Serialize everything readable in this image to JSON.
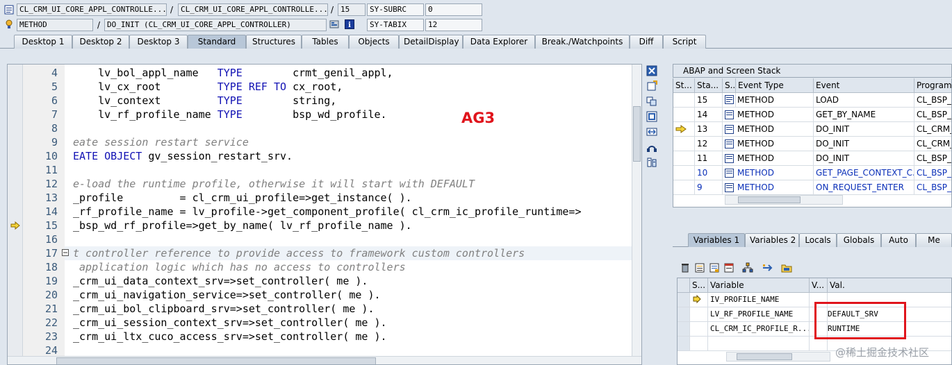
{
  "header": {
    "row1": {
      "field1": "CL_CRM_UI_CORE_APPL_CONTROLLE...",
      "sep1": "/",
      "field2": "CL_CRM_UI_CORE_APPL_CONTROLLE...",
      "sep2": "/",
      "line": "15",
      "sysvar": "SY-SUBRC",
      "sysval": "0"
    },
    "row2": {
      "type": "METHOD",
      "sep": "/",
      "method": "DO_INIT (CL_CRM_UI_CORE_APPL_CONTROLLER)",
      "sysvar": "SY-TABIX",
      "sysval": "12"
    }
  },
  "tabs": [
    "Desktop 1",
    "Desktop 2",
    "Desktop 3",
    "Standard",
    "Structures",
    "Tables",
    "Objects",
    "DetailDisplay",
    "Data Explorer",
    "Break./Watchpoints",
    "Diff",
    "Script"
  ],
  "editor": {
    "lines": [
      {
        "n": "4"
      },
      {
        "n": "5"
      },
      {
        "n": "6"
      },
      {
        "n": "7"
      },
      {
        "n": "8"
      },
      {
        "n": "9"
      },
      {
        "n": "10"
      },
      {
        "n": "11"
      },
      {
        "n": "12"
      },
      {
        "n": "13"
      },
      {
        "n": "14"
      },
      {
        "n": "15"
      },
      {
        "n": "16"
      },
      {
        "n": "17"
      },
      {
        "n": "18"
      },
      {
        "n": "19"
      },
      {
        "n": "20"
      },
      {
        "n": "21"
      },
      {
        "n": "22"
      },
      {
        "n": "23"
      },
      {
        "n": "24"
      }
    ],
    "code": {
      "l4a": "    lv_bol_appl_name   ",
      "l4b": "TYPE",
      "l4c": "        crmt_genil_appl,",
      "l5a": "    lv_cx_root         ",
      "l5b": "TYPE REF TO",
      "l5c": " cx_root,",
      "l6a": "    lv_context         ",
      "l6b": "TYPE",
      "l6c": "        string,",
      "l7a": "    lv_rf_profile_name ",
      "l7b": "TYPE",
      "l7c": "        bsp_wd_profile.",
      "l9": "eate session restart service",
      "l10a": "EATE OBJECT",
      "l10b": " gv_session_restart_srv.",
      "l12": "e-load the runtime profile, otherwise it will start with DEFAULT",
      "l13": "_profile         = cl_crm_ui_profile=>get_instance( ).",
      "l14": "_rf_profile_name = lv_profile->get_component_profile( cl_crm_ic_profile_runtime=>",
      "l15": "_bsp_wd_rf_profile=>get_by_name( lv_rf_profile_name ).",
      "l17": "t controller reference to provide access to framework custom controllers",
      "l18": " application logic which has no access to controllers",
      "l19": "_crm_ui_data_context_srv=>set_controller( me ).",
      "l20": "_crm_ui_navigation_service=>set_controller( me ).",
      "l21": "_crm_ui_bol_clipboard_srv=>set_controller( me ).",
      "l22": "_crm_ui_session_context_srv=>set_controller( me ).",
      "l23": "_crm_ui_ltx_cuco_access_srv=>set_controller( me )."
    }
  },
  "annotation": "AG3",
  "stack": {
    "title": "ABAP and Screen Stack",
    "columns": [
      "St...",
      "Sta...",
      "S...",
      "Event Type",
      "Event",
      "Program"
    ],
    "rows": [
      {
        "lvl": "15",
        "type": "METHOD",
        "event": "LOAD",
        "prog": "CL_BSP_W",
        "blue": false,
        "current": false
      },
      {
        "lvl": "14",
        "type": "METHOD",
        "event": "GET_BY_NAME",
        "prog": "CL_BSP_W",
        "blue": false,
        "current": false
      },
      {
        "lvl": "13",
        "type": "METHOD",
        "event": "DO_INIT",
        "prog": "CL_CRM_U",
        "blue": false,
        "current": true
      },
      {
        "lvl": "12",
        "type": "METHOD",
        "event": "DO_INIT",
        "prog": "CL_CRM_U",
        "blue": false,
        "current": false
      },
      {
        "lvl": "11",
        "type": "METHOD",
        "event": "DO_INIT",
        "prog": "CL_BSP_C",
        "blue": false,
        "current": false
      },
      {
        "lvl": "10",
        "type": "METHOD",
        "event": "GET_PAGE_CONTEXT_C...",
        "prog": "CL_BSP_C",
        "blue": true,
        "current": false
      },
      {
        "lvl": "9",
        "type": "METHOD",
        "event": "ON_REQUEST_ENTER",
        "prog": "CL_BSP_R",
        "blue": true,
        "current": false
      }
    ]
  },
  "vartabs": [
    "Variables 1",
    "Variables 2",
    "Locals",
    "Globals",
    "Auto",
    "Me"
  ],
  "vars": {
    "columns": [
      "S...",
      "Variable",
      "V...",
      "Val."
    ],
    "rows": [
      {
        "name": "IV_PROFILE_NAME",
        "val": ""
      },
      {
        "name": "LV_RF_PROFILE_NAME",
        "val": "DEFAULT_SRV"
      },
      {
        "name": "CL_CRM_IC_PROFILE_R...",
        "val": "RUNTIME"
      },
      {
        "name": "",
        "val": ""
      }
    ]
  },
  "watermark": "@稀土掘金技术社区",
  "colors": {
    "keyword": "#1212b4",
    "comment": "#808080",
    "highlight": "#e0141c",
    "link": "#0a2fb8"
  }
}
